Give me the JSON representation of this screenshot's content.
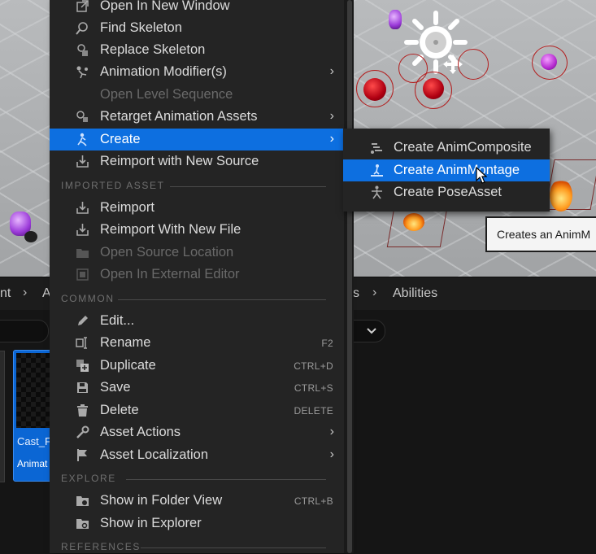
{
  "breadcrumb": {
    "part_left": "nt",
    "part_mid": "A",
    "part_right": "s",
    "current": "Abilities"
  },
  "asset_tile": {
    "name": "Cast_F",
    "type": "Animat"
  },
  "context_menu": {
    "items_top": [
      {
        "label": "Open In New Window",
        "icon": "open-window-icon",
        "disabled": false,
        "submenu": false
      },
      {
        "label": "Find Skeleton",
        "icon": "find-skeleton-icon",
        "disabled": false,
        "submenu": false
      },
      {
        "label": "Replace Skeleton",
        "icon": "replace-skeleton-icon",
        "disabled": false,
        "submenu": false
      },
      {
        "label": "Animation Modifier(s)",
        "icon": "animation-modifier-icon",
        "disabled": false,
        "submenu": true
      },
      {
        "label": "Open Level Sequence",
        "icon": "",
        "disabled": true,
        "submenu": false
      },
      {
        "label": "Retarget Animation Assets",
        "icon": "retarget-icon",
        "disabled": false,
        "submenu": true
      },
      {
        "label": "Create",
        "icon": "create-anim-icon",
        "disabled": false,
        "submenu": true,
        "active": true
      },
      {
        "label": "Reimport with New Source",
        "icon": "reimport-icon",
        "disabled": false,
        "submenu": false
      }
    ],
    "section_imported": "IMPORTED ASSET",
    "items_imported": [
      {
        "label": "Reimport",
        "icon": "reimport-icon",
        "disabled": false
      },
      {
        "label": "Reimport With New File",
        "icon": "reimport-file-icon",
        "disabled": false
      },
      {
        "label": "Open Source Location",
        "icon": "folder-icon",
        "disabled": true
      },
      {
        "label": "Open In External Editor",
        "icon": "external-editor-icon",
        "disabled": true
      }
    ],
    "section_common": "COMMON",
    "items_common": [
      {
        "label": "Edit...",
        "icon": "edit-icon",
        "shortcut": "",
        "submenu": false
      },
      {
        "label": "Rename",
        "icon": "rename-icon",
        "shortcut": "F2",
        "submenu": false
      },
      {
        "label": "Duplicate",
        "icon": "duplicate-icon",
        "shortcut": "CTRL+D",
        "submenu": false
      },
      {
        "label": "Save",
        "icon": "save-icon",
        "shortcut": "CTRL+S",
        "submenu": false
      },
      {
        "label": "Delete",
        "icon": "delete-icon",
        "shortcut": "DELETE",
        "submenu": false
      },
      {
        "label": "Asset Actions",
        "icon": "wrench-icon",
        "shortcut": "",
        "submenu": true
      },
      {
        "label": "Asset Localization",
        "icon": "flag-icon",
        "shortcut": "",
        "submenu": true
      }
    ],
    "section_explore": "EXPLORE",
    "items_explore": [
      {
        "label": "Show in Folder View",
        "icon": "folder-view-icon",
        "shortcut": "CTRL+B"
      },
      {
        "label": "Show in Explorer",
        "icon": "explorer-icon",
        "shortcut": ""
      }
    ],
    "section_references": "REFERENCES"
  },
  "submenu": {
    "items": [
      {
        "label": "Create AnimComposite",
        "icon": "anim-composite-icon",
        "active": false
      },
      {
        "label": "Create AnimMontage",
        "icon": "anim-montage-icon",
        "active": true
      },
      {
        "label": "Create PoseAsset",
        "icon": "pose-asset-icon",
        "active": false
      }
    ]
  },
  "tooltip": {
    "text": "Creates an AnimM"
  },
  "colors": {
    "menu_bg": "#242424",
    "highlight": "#0d6fe0",
    "text": "#dcdcdc",
    "text_disabled": "#6a6a6a",
    "section": "#6f6f6f"
  }
}
